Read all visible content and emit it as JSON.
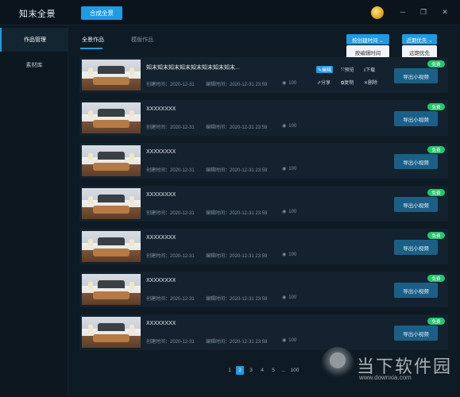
{
  "app": {
    "logo": "知末全景",
    "compose_button": "合成全景"
  },
  "window_controls": {
    "minimize": "─",
    "maximize": "❐",
    "close": "✕"
  },
  "sidebar": {
    "items": [
      {
        "label": "作品管理",
        "active": true
      },
      {
        "label": "素材库",
        "active": false
      }
    ]
  },
  "tabs": [
    {
      "label": "全景作品",
      "active": true
    },
    {
      "label": "模版作品",
      "active": false
    }
  ],
  "sort": {
    "primary": {
      "label": "按创建时间 ⌄",
      "option": "按编辑时间"
    },
    "secondary": {
      "label": "近期优先 ⌄",
      "option": "远期优先"
    }
  },
  "actions": {
    "edit": "✎编辑",
    "preview": "⤧预览",
    "download": "⭳下载",
    "share": "⇗分享",
    "copy": "⧉复制",
    "delete": "✕删除"
  },
  "rows": [
    {
      "title": "知末知末知末知末知末知末知末知末...",
      "created": "创建时间：2020-12-31",
      "edited": "编辑时间：2020-12-31 23:59",
      "views": "100",
      "badge": "免费",
      "export": "导出小视频"
    },
    {
      "title": "XXXXXXXX",
      "created": "创建时间：2020-12-31",
      "edited": "编辑时间：2020-12-31 23:59",
      "views": "100",
      "badge": "免费",
      "export": "导出小视频"
    },
    {
      "title": "XXXXXXXX",
      "created": "创建时间：2020-12-31",
      "edited": "编辑时间：2020-12-31 23:59",
      "views": "100",
      "badge": "免费",
      "export": "导出小视频"
    },
    {
      "title": "XXXXXXXX",
      "created": "创建时间：2020-12-31",
      "edited": "编辑时间：2020-12-31 23:59",
      "views": "100",
      "badge": "免费",
      "export": "导出小视频"
    },
    {
      "title": "XXXXXXXX",
      "created": "创建时间：2020-12-31",
      "edited": "编辑时间：2020-12-31 23:59",
      "views": "100",
      "badge": "免费",
      "export": "导出小视频"
    },
    {
      "title": "XXXXXXXX",
      "created": "创建时间：2020-12-31",
      "edited": "编辑时间：2020-12-31 23:59",
      "views": "100",
      "badge": "免费",
      "export": "导出小视频"
    },
    {
      "title": "XXXXXXXX",
      "created": "创建时间：2020-12-31",
      "edited": "编辑时间：2020-12-31 23:59",
      "views": "100",
      "badge": "免费",
      "export": "导出小视频"
    }
  ],
  "pagination": {
    "pages": [
      "1",
      "2",
      "3",
      "4",
      "5",
      "...",
      "100"
    ],
    "current": "2"
  },
  "watermark": {
    "text": "当下软件园",
    "url": "www.downxia.com"
  },
  "colors": {
    "accent": "#1e9be3",
    "badge": "#26c66e",
    "background": "#0e1a24"
  }
}
